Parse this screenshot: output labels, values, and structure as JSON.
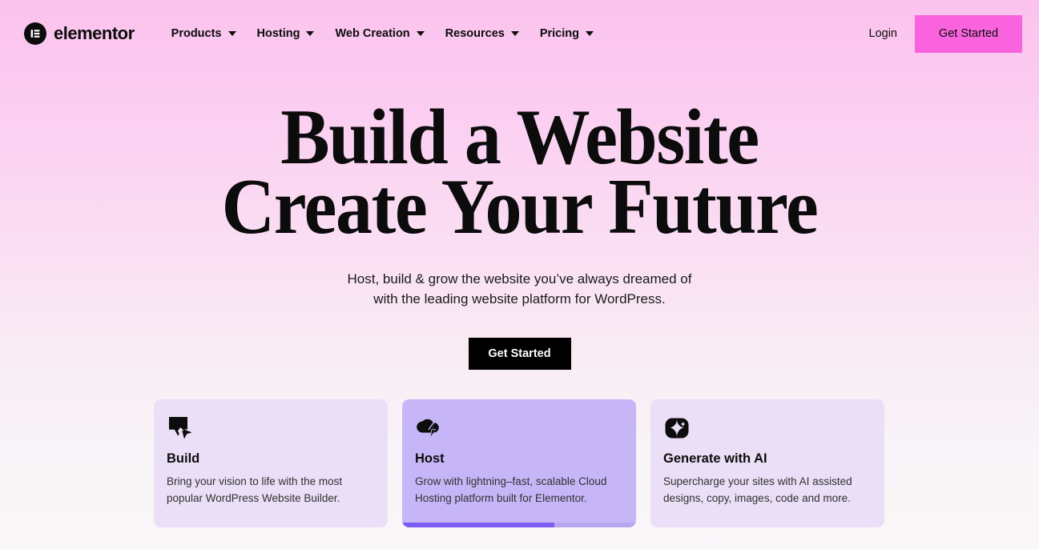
{
  "brand": {
    "logo_text": "elementor",
    "logo_icon": "elementor-logo-icon",
    "accent_pink": "#F963DD",
    "bg_top": "#FBC3EE",
    "bg_bottom": "#FAF7FA",
    "card_bg": "#EADFF6",
    "card_active_bg": "#C7B6F7",
    "progress_fill": "#7C5CF5"
  },
  "header": {
    "nav": [
      {
        "label": "Products",
        "has_dropdown": true,
        "icon": "chevron-down-icon"
      },
      {
        "label": "Hosting",
        "has_dropdown": true,
        "icon": "chevron-down-icon"
      },
      {
        "label": "Web Creation",
        "has_dropdown": true,
        "icon": "chevron-down-icon"
      },
      {
        "label": "Resources",
        "has_dropdown": true,
        "icon": "chevron-down-icon"
      },
      {
        "label": "Pricing",
        "has_dropdown": true,
        "icon": "chevron-down-icon"
      }
    ],
    "login_label": "Login",
    "get_started_label": "Get Started"
  },
  "hero": {
    "title_line1": "Build a Website",
    "title_line2": "Create Your Future",
    "subtitle_line1": "Host, build & grow the website you’ve always dreamed of",
    "subtitle_line2": "with the leading website platform for WordPress.",
    "cta_label": "Get Started"
  },
  "cards": [
    {
      "id": "build",
      "icon": "cursor-square-icon",
      "title": "Build",
      "desc_line1": "Bring your vision to life with the most",
      "desc_line2": "popular WordPress Website Builder.",
      "active": false,
      "progress": null
    },
    {
      "id": "host",
      "icon": "cloud-lightning-icon",
      "title": "Host",
      "desc_line1": "Grow with lightning–fast, scalable Cloud",
      "desc_line2": "Hosting platform built for Elementor.",
      "active": true,
      "progress": 65
    },
    {
      "id": "generate-with-ai",
      "icon": "ai-sparkle-icon",
      "title": "Generate with AI",
      "desc_line1": "Supercharge your sites with AI assisted",
      "desc_line2": "designs, copy, images, code and more.",
      "active": false,
      "progress": null
    }
  ]
}
